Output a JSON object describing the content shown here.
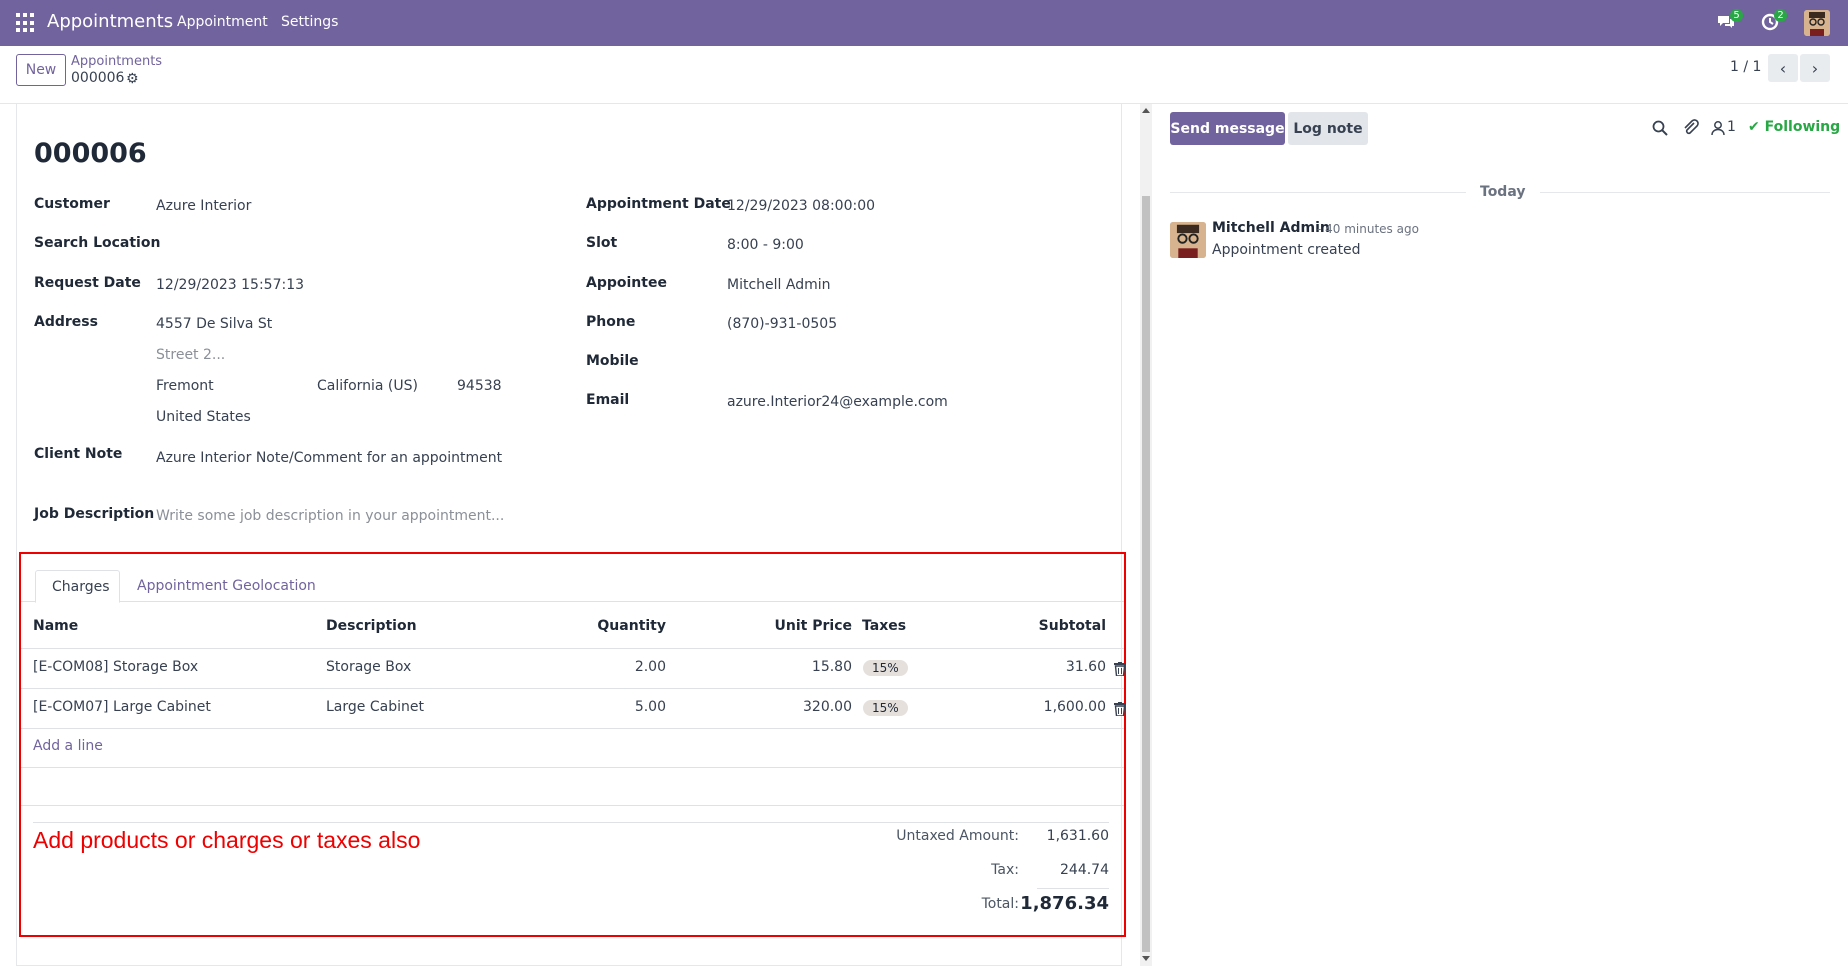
{
  "navbar": {
    "app_name": "Appointments",
    "menu": [
      "Appointment",
      "Settings"
    ],
    "messages_badge": "5",
    "activities_badge": "2",
    "colors": {
      "navbar_bg": "#71639e",
      "badge": "#28a745"
    }
  },
  "control_panel": {
    "new_label": "New",
    "breadcrumb_parent": "Appointments",
    "breadcrumb_current": "000006",
    "pager_value": "1 / 1"
  },
  "form": {
    "title": "000006",
    "left": {
      "customer_label": "Customer",
      "customer_value": "Azure Interior",
      "search_location_label": "Search Location",
      "request_date_label": "Request Date",
      "request_date_value": "12/29/2023 15:57:13",
      "address_label": "Address",
      "street": "4557 De Silva St",
      "street2_placeholder": "Street 2...",
      "city": "Fremont",
      "state": "California (US)",
      "zip": "94538",
      "country": "United States",
      "client_note_label": "Client Note",
      "client_note_value": "Azure Interior Note/Comment for an appointment",
      "job_description_label": "Job Description",
      "job_description_placeholder": "Write some job description in your appointment..."
    },
    "right": {
      "appointment_date_label": "Appointment Date",
      "appointment_date_value": "12/29/2023 08:00:00",
      "slot_label": "Slot",
      "slot_value": "8:00 - 9:00",
      "appointee_label": "Appointee",
      "appointee_value": "Mitchell Admin",
      "phone_label": "Phone",
      "phone_value": "(870)-931-0505",
      "mobile_label": "Mobile",
      "email_label": "Email",
      "email_value": "azure.Interior24@example.com"
    }
  },
  "notebook": {
    "tabs": [
      "Charges",
      "Appointment Geolocation"
    ],
    "active_tab": "Charges",
    "columns": [
      "Name",
      "Description",
      "Quantity",
      "Unit Price",
      "Taxes",
      "Subtotal"
    ],
    "rows": [
      {
        "name": "[E-COM08] Storage Box",
        "description": "Storage Box",
        "quantity": "2.00",
        "unit_price": "15.80",
        "tax": "15%",
        "subtotal": "31.60"
      },
      {
        "name": "[E-COM07] Large Cabinet",
        "description": "Large Cabinet",
        "quantity": "5.00",
        "unit_price": "320.00",
        "tax": "15%",
        "subtotal": "1,600.00"
      }
    ],
    "add_line": "Add a line",
    "annotation": "Add products or charges or taxes  also",
    "totals": {
      "untaxed_label": "Untaxed Amount:",
      "untaxed_value": "1,631.60",
      "tax_label": "Tax:",
      "tax_value": "244.74",
      "total_label": "Total:",
      "total_value": "1,876.34"
    }
  },
  "chatter": {
    "send_message": "Send message",
    "log_note": "Log note",
    "followers_count": "1",
    "following_label": "Following",
    "date_separator": "Today",
    "message": {
      "author": "Mitchell Admin",
      "time": "- 40 minutes ago",
      "body": "Appointment created"
    }
  }
}
